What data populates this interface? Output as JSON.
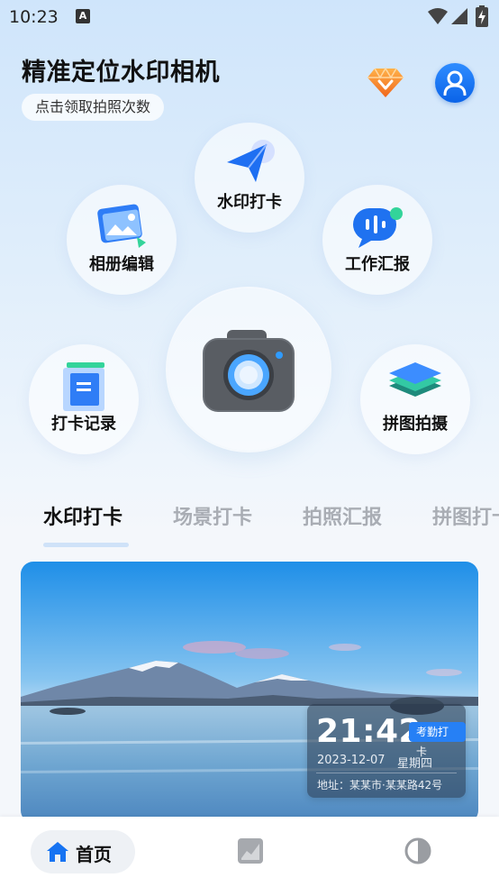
{
  "status_bar": {
    "time": "10:23",
    "indicator": "A",
    "icons": [
      "wifi-icon",
      "signal-icon",
      "battery-charging-icon"
    ]
  },
  "header": {
    "title": "精准定位水印相机",
    "promo_chip": "点击领取拍照次数",
    "vip_icon": "diamond-icon",
    "user_icon": "user-avatar-icon"
  },
  "features": [
    {
      "label": "水印打卡",
      "icon": "send-arrow-icon"
    },
    {
      "label": "相册编辑",
      "icon": "photo-edit-icon"
    },
    {
      "label": "工作汇报",
      "icon": "voice-report-icon"
    },
    {
      "label": "打卡记录",
      "icon": "record-document-icon"
    },
    {
      "label": "拼图拍摄",
      "icon": "layers-icon"
    }
  ],
  "camera_button": {
    "icon": "camera-icon"
  },
  "tabs": [
    {
      "label": "水印打卡",
      "active": true
    },
    {
      "label": "场景打卡",
      "active": false
    },
    {
      "label": "拍照汇报",
      "active": false
    },
    {
      "label": "拼图打卡",
      "active": false
    }
  ],
  "watermark": {
    "time": "21:42",
    "badge": "考勤打卡",
    "date": "2023-12-07",
    "weekday": "星期四",
    "address": "地址：某某市·某某路42号"
  },
  "bottom_nav": [
    {
      "label": "首页",
      "icon": "home-icon",
      "active": true
    },
    {
      "label": "",
      "icon": "chart-trend-icon",
      "active": false
    },
    {
      "label": "",
      "icon": "half-circle-icon",
      "active": false
    }
  ],
  "colors": {
    "accent": "#1673f2",
    "background_top": "#cfe5fb",
    "watermark_badge": "#2680f5"
  }
}
